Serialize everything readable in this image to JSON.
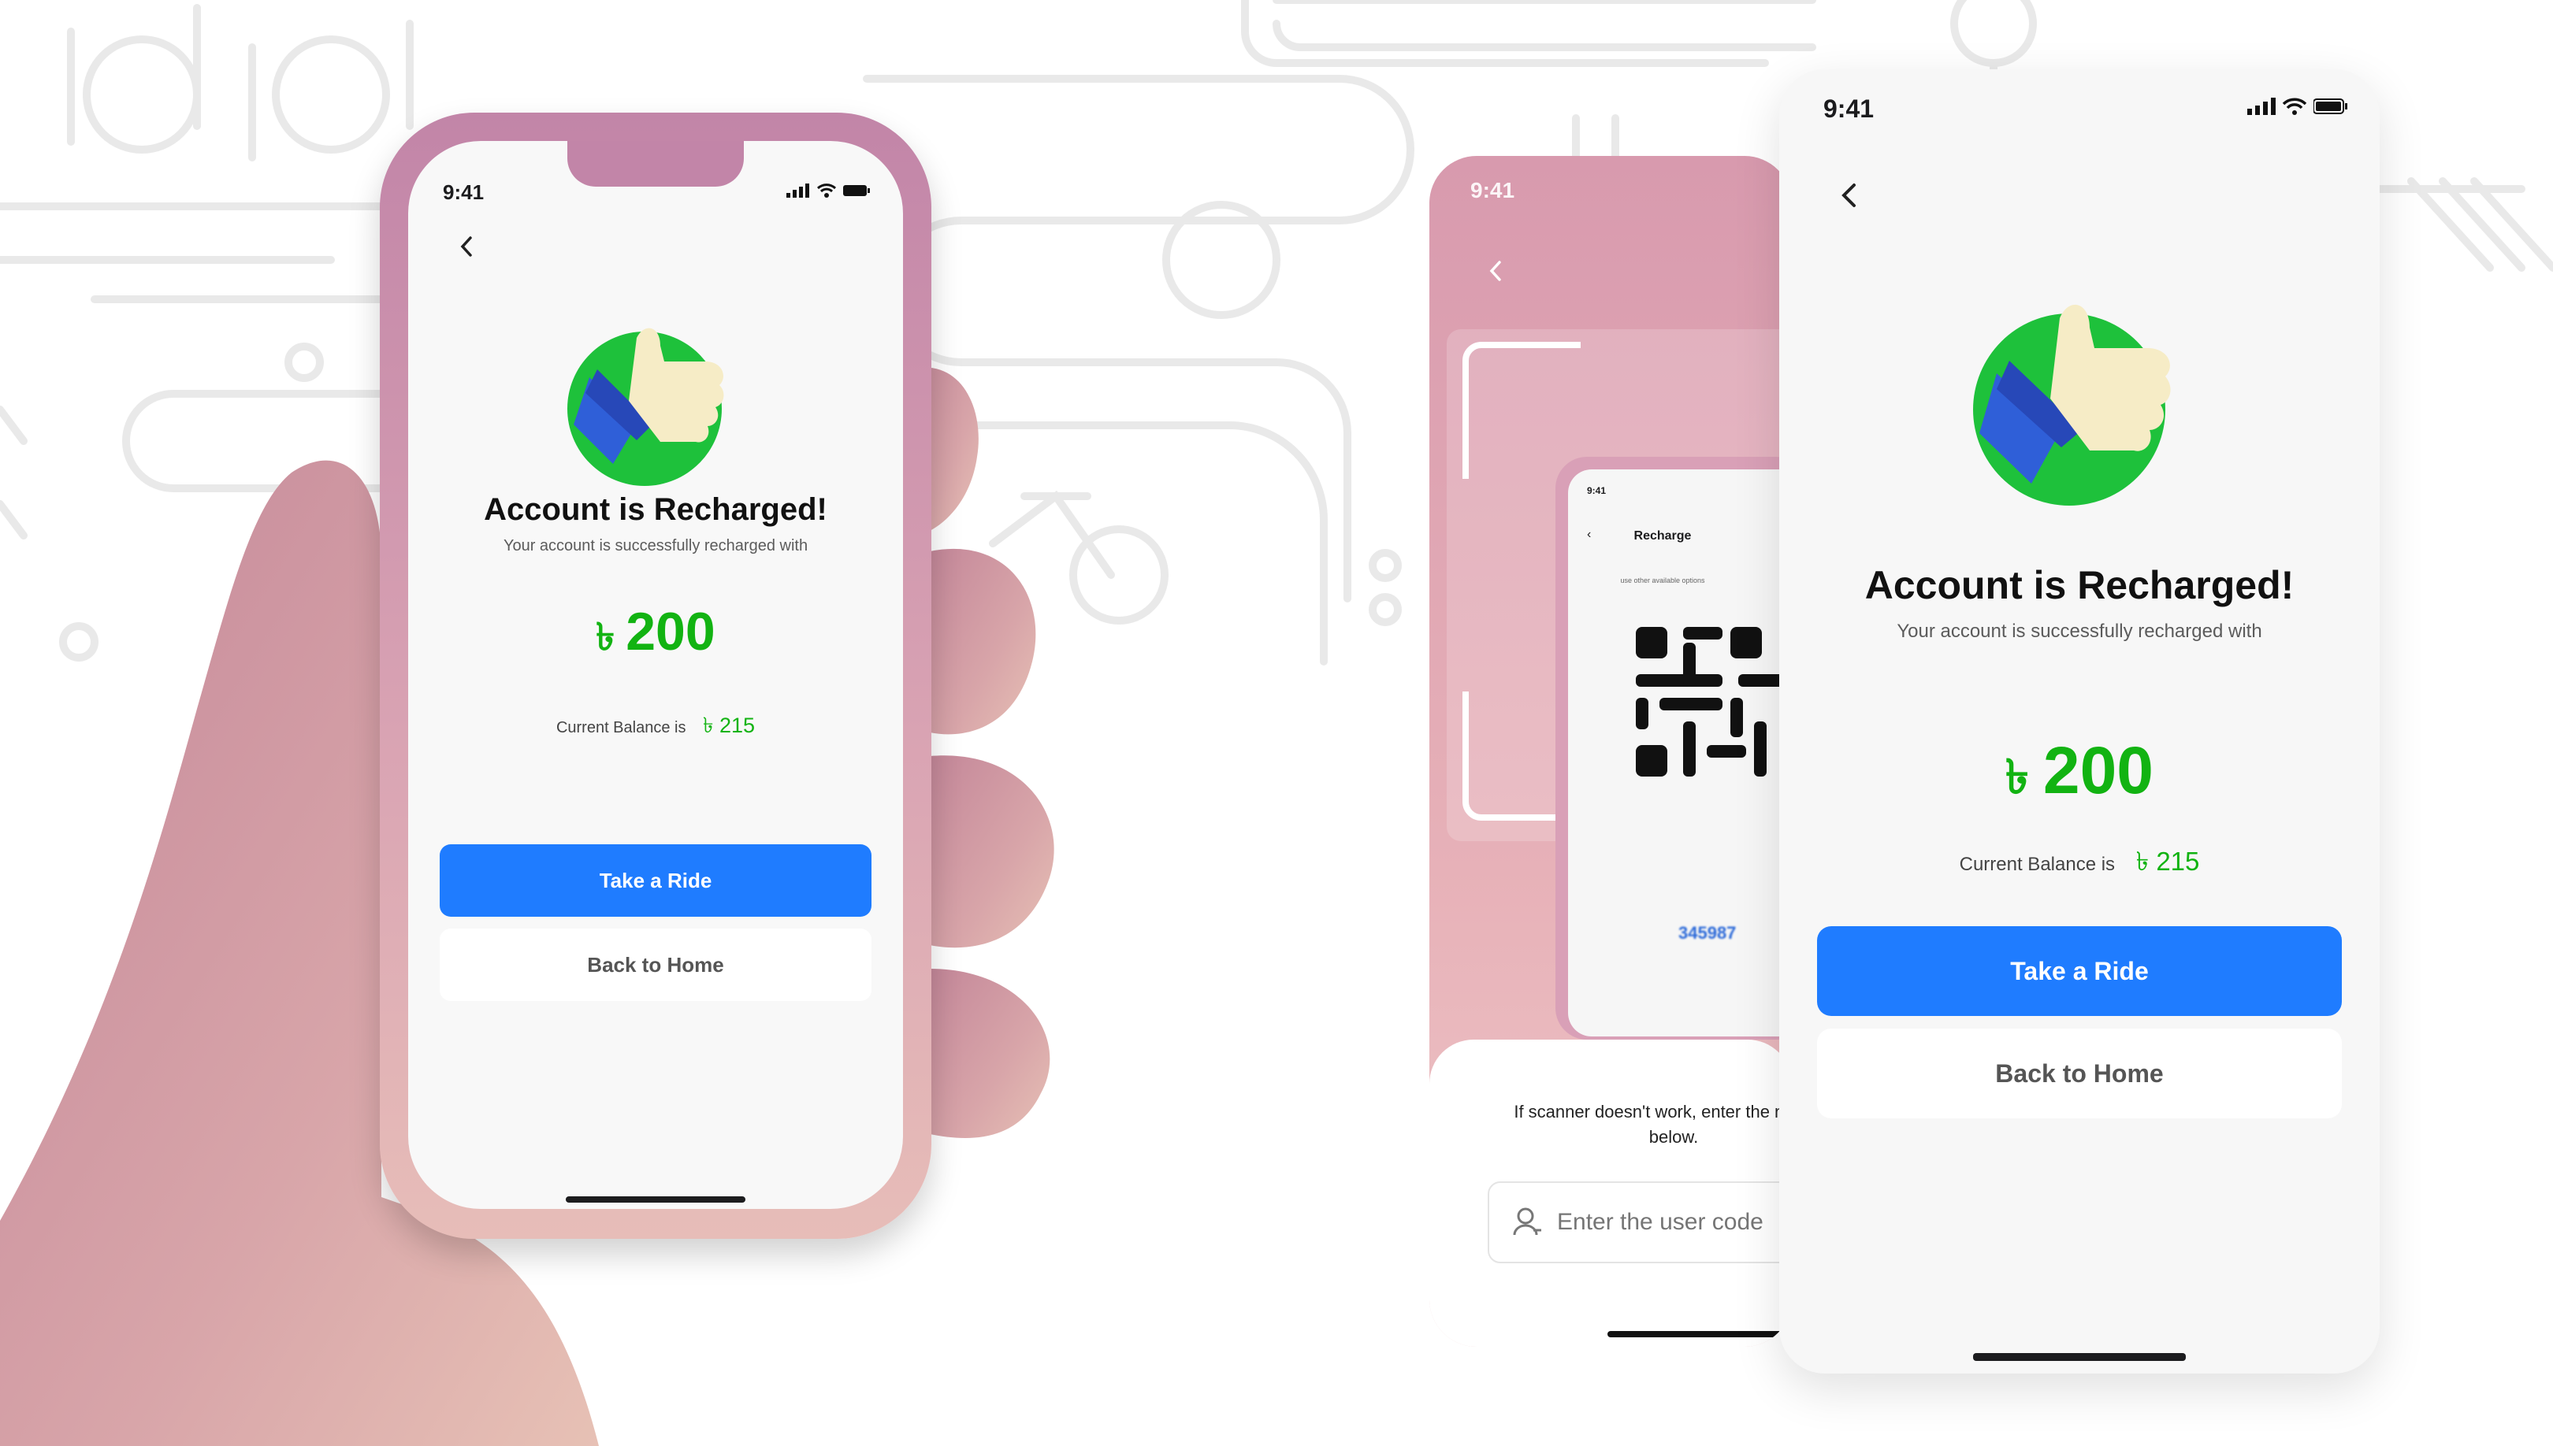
{
  "colors": {
    "accent_blue": "#1f7cff",
    "success_green": "#12b312",
    "phone_pink": "#c285a8",
    "pattern_gray": "#e6e6e6"
  },
  "left_phone": {
    "status_time": "9:41",
    "icons": [
      "back-icon",
      "thumbs-up-illustration"
    ],
    "title": "Account is Recharged!",
    "subtitle": "Your account is successfully recharged with",
    "amount_currency": "৳",
    "amount_value": "200",
    "balance_label": "Current Balance is",
    "balance_currency": "৳",
    "balance_value": "215",
    "primary_button": "Take a Ride",
    "secondary_button": "Back to Home"
  },
  "scanner_phone": {
    "status_time": "9:41",
    "inner_screen": {
      "status_time": "9:41",
      "title": "Recharge",
      "hint": "use other available options",
      "code_value": "345987"
    },
    "helper_text": "If scanner doesn't work, enter the number below.",
    "input_placeholder": "Enter the user code"
  },
  "right_phone": {
    "status_time": "9:41",
    "title": "Account is Recharged!",
    "subtitle": "Your account is successfully recharged with",
    "amount_currency": "৳",
    "amount_value": "200",
    "balance_label": "Current Balance is",
    "balance_currency": "৳",
    "balance_value": "215",
    "primary_button": "Take a Ride",
    "secondary_button": "Back to Home"
  }
}
